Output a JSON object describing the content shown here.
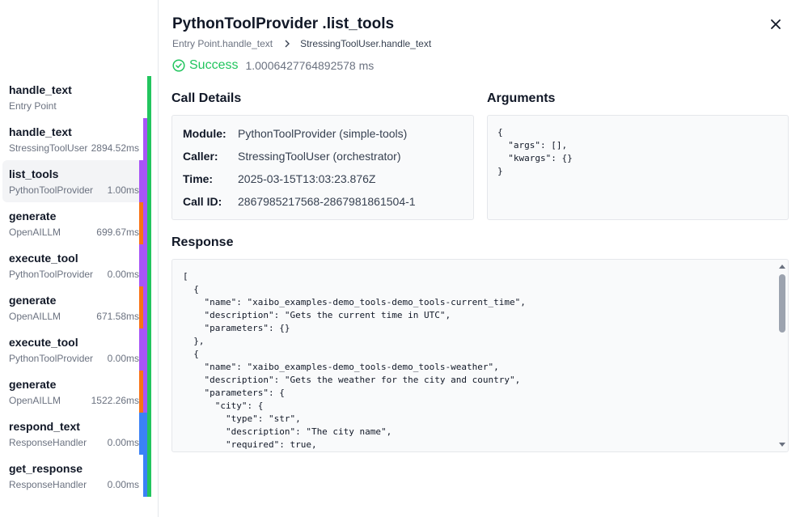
{
  "sidebar": {
    "items": [
      {
        "name": "handle_text",
        "module": "Entry Point",
        "duration": "",
        "bar_color": "#22c55e"
      },
      {
        "name": "handle_text",
        "module": "StressingToolUser",
        "duration": "2894.52ms",
        "bar_color": "#a855f7"
      },
      {
        "name": "list_tools",
        "module": "PythonToolProvider",
        "duration": "1.00ms",
        "bar_color": "#a855f7"
      },
      {
        "name": "generate",
        "module": "OpenAILLM",
        "duration": "699.67ms",
        "bar_color": "#f97316"
      },
      {
        "name": "execute_tool",
        "module": "PythonToolProvider",
        "duration": "0.00ms",
        "bar_color": "#a855f7"
      },
      {
        "name": "generate",
        "module": "OpenAILLM",
        "duration": "671.58ms",
        "bar_color": "#f97316"
      },
      {
        "name": "execute_tool",
        "module": "PythonToolProvider",
        "duration": "0.00ms",
        "bar_color": "#a855f7"
      },
      {
        "name": "generate",
        "module": "OpenAILLM",
        "duration": "1522.26ms",
        "bar_color": "#f97316"
      },
      {
        "name": "respond_text",
        "module": "ResponseHandler",
        "duration": "0.00ms",
        "bar_color": "#3b82f6"
      },
      {
        "name": "get_response",
        "module": "ResponseHandler",
        "duration": "0.00ms",
        "bar_color": "#3b82f6"
      }
    ],
    "selected_index": 2
  },
  "header": {
    "title": "PythonToolProvider .list_tools",
    "breadcrumb": [
      "Entry Point.handle_text",
      "StressingToolUser.handle_text"
    ],
    "status": "Success",
    "status_duration": "1.0006427764892578 ms"
  },
  "call_details": {
    "title": "Call Details",
    "rows": [
      {
        "label": "Module:",
        "value": "PythonToolProvider (simple-tools)"
      },
      {
        "label": "Caller:",
        "value": "StressingToolUser (orchestrator)"
      },
      {
        "label": "Time:",
        "value": "2025-03-15T13:03:23.876Z"
      },
      {
        "label": "Call ID:",
        "value": "2867985217568-2867981861504-1"
      }
    ]
  },
  "arguments": {
    "title": "Arguments",
    "json": "{\n  \"args\": [],\n  \"kwargs\": {}\n}"
  },
  "response": {
    "title": "Response",
    "json": "[\n  {\n    \"name\": \"xaibo_examples-demo_tools-demo_tools-current_time\",\n    \"description\": \"Gets the current time in UTC\",\n    \"parameters\": {}\n  },\n  {\n    \"name\": \"xaibo_examples-demo_tools-demo_tools-weather\",\n    \"description\": \"Gets the weather for the city and country\",\n    \"parameters\": {\n      \"city\": {\n        \"type\": \"str\",\n        \"description\": \"The city name\",\n        \"required\": true,"
  },
  "colors": {
    "success": "#22c55e",
    "purple": "#a855f7",
    "orange": "#f97316",
    "blue": "#3b82f6",
    "green": "#22c55e"
  },
  "icons": {
    "close": "close-icon",
    "breadcrumb_separator": "chevron-right-icon",
    "status": "check-circle-icon"
  }
}
